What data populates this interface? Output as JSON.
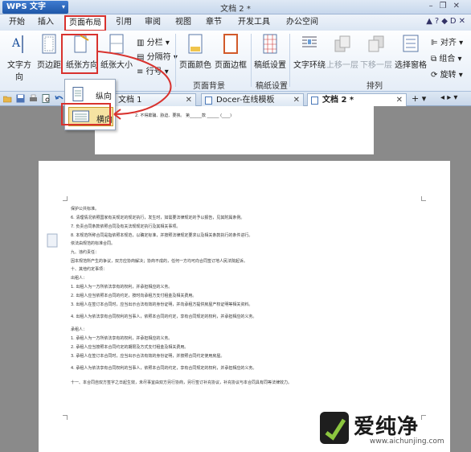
{
  "app": {
    "name": "WPS 文字",
    "window_title": "文档 2 *"
  },
  "menu": {
    "tabs": [
      "开始",
      "插入",
      "页面布局",
      "引用",
      "审阅",
      "视图",
      "章节",
      "开发工具",
      "办公空间"
    ],
    "active": "页面布局"
  },
  "ribbon": {
    "text_direction": "文字方向",
    "margins": "页边距",
    "orientation": "纸张方向",
    "paper_size": "纸张大小",
    "columns": "分栏",
    "breaks": "分隔符",
    "line_numbers": "行号",
    "page_color": "页面颜色",
    "page_border": "页面边框",
    "page_bg_group": "页面背景",
    "paper_settings": "稿纸设置",
    "paper_group": "稿纸设置",
    "text_wrap": "文字环绕",
    "bring_forward": "上移一层",
    "send_backward": "下移一层",
    "selection_pane": "选择窗格",
    "arrange_group": "排列",
    "align": "对齐",
    "group": "组合",
    "rotate": "旋转"
  },
  "orientation_menu": {
    "portrait": "纵向",
    "landscape": "横向",
    "selected": "landscape"
  },
  "doc_tabs": [
    {
      "label": "文档 1",
      "active": false
    },
    {
      "label": "Docer-在线模板",
      "active": false
    },
    {
      "label": "文档 2 *",
      "active": true
    }
  ],
  "document": {
    "page1_line": "2. 不得欺骗、胁迫、要挟。 第______款 ______ (____)",
    "lines": [
      "保护公共标准。",
      "6. 清理情况依照国家有关规定的规定执行，发生时，如需要法律规定的予以报告，见其附属条例。",
      "7. 负责合同条款依照合同及有关法规规定执行及其相关事项。",
      "8. 本规范所称合同是指依照本规范，以确定标准，并按照法律规定要求以及相关条款执行的条件进行。",
      "依法由规范的标准合同。",
      "九、违约责任：",
      "因本规范所产生的争议，双方应协商解决；协商不成的，任何一方均可向合同签订地人民法院起诉。",
      "十、其他约定事项：",
      "出租人：",
      "1. 出租人为一方所依法享有的权利，并承担相应的义务。",
      "2. 出租人应当依照本合同的约定，按时向承租方支付租金及相关费用。",
      "3. 出租人在签订本合同时，应当出示合法有效的身份证明，并向承租方提供房屋产权证明等相关资料。",
      "4. 出租人为依法享有合同权利的当事人，依照本合同的约定，享有合同规定的权利，并承担相应的义务。",
      "承租人：",
      "1. 承租人为一方所依法享有的权利，并承担相应的义务。",
      "2. 承租人应当按照本合同约定的期限及方式支付租金及相关费用。",
      "3. 承租人在签订本合同时，应当出示合法有效的身份证明，并按照合同约定使用房屋。",
      "4. 承租人为依法享有合同权利的当事人，依照本合同的约定，享有合同规定的权利，并承担相应的义务。",
      "十一、本合同自双方签字之日起生效，未尽事宜由双方另行协商，另行签订补充协议，补充协议与本合同具有同等法律效力。"
    ]
  },
  "watermark": {
    "brand": "爱纯净",
    "url": "www.aichunjing.com"
  },
  "colors": {
    "highlight_red": "#d8322e",
    "selected_item": "#f6e3a2",
    "doc_bg": "#8a8a8a"
  }
}
